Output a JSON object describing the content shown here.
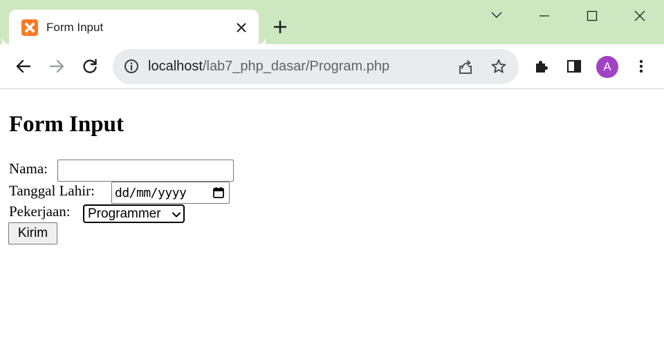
{
  "tab": {
    "title": "Form Input",
    "favicon_color": "#fb7a24"
  },
  "window": {
    "tabbar_color": "#cde8c1"
  },
  "toolbar": {
    "url_host": "localhost",
    "url_path": "/lab7_php_dasar/Program.php",
    "avatar_letter": "A",
    "avatar_color": "#a142c5"
  },
  "icons": [
    "xampp-favicon-icon",
    "close-icon",
    "plus-icon",
    "chevron-down-icon",
    "minimize-icon",
    "maximize-icon",
    "close-window-icon",
    "back-arrow-icon",
    "forward-arrow-icon",
    "reload-icon",
    "info-icon",
    "share-icon",
    "star-icon",
    "puzzle-icon",
    "side-panel-icon",
    "kebab-menu-icon",
    "calendar-icon"
  ],
  "page": {
    "heading": "Form Input",
    "nama_label": "Nama:",
    "nama_value": "",
    "tanggal_label": "Tanggal Lahir:",
    "tanggal_placeholder": "dd/mm/yyyy",
    "pekerjaan_label": "Pekerjaan:",
    "pekerjaan_selected": "Programmer",
    "submit_label": "Kirim"
  }
}
